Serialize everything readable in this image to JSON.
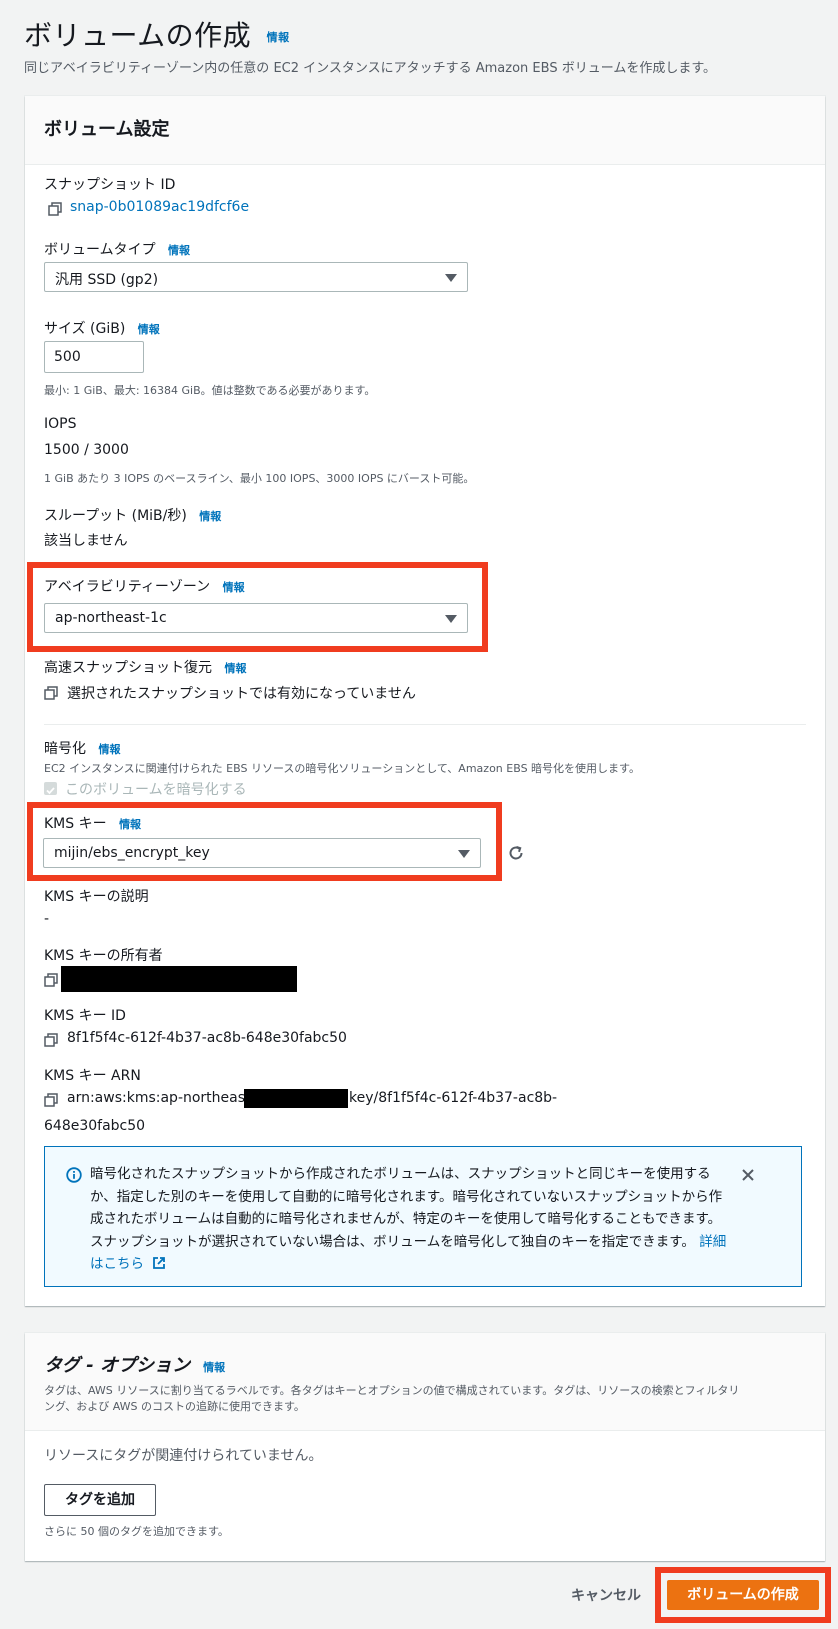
{
  "page": {
    "title": "ボリュームの作成",
    "info": "情報",
    "subtitle": "同じアベイラビリティーゾーン内の任意の EC2 インスタンスにアタッチする Amazon EBS ボリュームを作成します。"
  },
  "volume_settings": {
    "title": "ボリューム設定",
    "snapshot": {
      "label": "スナップショット ID",
      "value": "snap-0b01089ac19dfcf6e"
    },
    "volume_type": {
      "label": "ボリュームタイプ",
      "info": "情報",
      "value": "汎用 SSD (gp2)"
    },
    "size": {
      "label": "サイズ (GiB)",
      "info": "情報",
      "value": "500",
      "hint": "最小: 1 GiB、最大: 16384 GiB。値は整数である必要があります。"
    },
    "iops": {
      "label": "IOPS",
      "value": "1500 / 3000",
      "hint": "1 GiB あたり 3 IOPS のベースライン、最小 100 IOPS、3000 IOPS にバースト可能。"
    },
    "throughput": {
      "label": "スループット (MiB/秒)",
      "info": "情報",
      "value": "該当しません"
    },
    "availability_zone": {
      "label": "アベイラビリティーゾーン",
      "info": "情報",
      "value": "ap-northeast-1c"
    },
    "fast_restore": {
      "label": "高速スナップショット復元",
      "info": "情報",
      "value": "選択されたスナップショットでは有効になっていません"
    },
    "encryption": {
      "label": "暗号化",
      "info": "情報",
      "hint": "EC2 インスタンスに関連付けられた EBS リソースの暗号化ソリューションとして、Amazon EBS 暗号化を使用します。",
      "checkbox_label": "このボリュームを暗号化する",
      "checked": true
    },
    "kms_key": {
      "label": "KMS キー",
      "info": "情報",
      "value": "mijin/ebs_encrypt_key"
    },
    "kms_description": {
      "label": "KMS キーの説明",
      "value": "-"
    },
    "kms_owner": {
      "label": "KMS キーの所有者"
    },
    "kms_id": {
      "label": "KMS キー ID",
      "value": "8f1f5f4c-612f-4b37-ac8b-648e30fabc50"
    },
    "kms_arn": {
      "label": "KMS キー ARN",
      "value_prefix": "arn:aws:kms:ap-northeast-1",
      "value_suffix": "key/8f1f5f4c-612f-4b37-ac8b-",
      "value_line2": "648e30fabc50"
    },
    "alert": {
      "line1": "暗号化されたスナップショットから作成されたボリュームは、スナップショットと同じキーを使用する",
      "line2": "か、指定した別のキーを使用して自動的に暗号化されます。暗号化されていないスナップショットから作",
      "line3": "成されたボリュームは自動的に暗号化されませんが、特定のキーを使用して暗号化することもできます。",
      "line4": "スナップショットが選択されていない場合は、ボリュームを暗号化して独自のキーを指定できます。",
      "link1": "詳細",
      "link2": "はこちら"
    }
  },
  "tags": {
    "title": "タグ - オプション",
    "info": "情報",
    "desc_line1": "タグは、AWS リソースに割り当てるラベルです。各タグはキーとオプションの値で構成されています。タグは、リソースの検索とフィルタリ",
    "desc_line2": "ング、および AWS のコストの追跡に使用できます。",
    "empty": "リソースにタグが関連付けられていません。",
    "add_button": "タグを追加",
    "remaining": "さらに 50 個のタグを追加できます。"
  },
  "footer": {
    "cancel": "キャンセル",
    "create": "ボリュームの作成"
  },
  "colors": {
    "accent": "#0073bb",
    "primary_button": "#ec7211",
    "highlight": "#f03c1f"
  }
}
